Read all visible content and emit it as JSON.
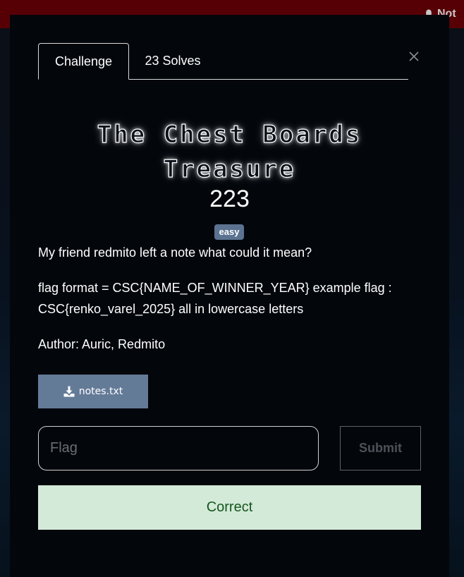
{
  "topbar": {
    "notifications_label": "Not"
  },
  "tabs": [
    {
      "label": "Challenge"
    },
    {
      "label": "23 Solves"
    }
  ],
  "challenge": {
    "title": "The Chest Boards Treasure",
    "points": "223",
    "difficulty": "easy",
    "description": [
      "My friend redmito left a note what could it mean?",
      "flag format = CSC{NAME_OF_WINNER_YEAR} example flag : CSC{renko_varel_2025} all in lowercase letters",
      "Author: Auric, Redmito"
    ]
  },
  "file": {
    "name": "notes.txt",
    "icon": "download-icon"
  },
  "form": {
    "flag_placeholder": "Flag",
    "flag_value": "",
    "submit_label": "Submit"
  },
  "result": {
    "message": "Correct"
  },
  "colors": {
    "header": "#560006",
    "modal_bg": "#03070c",
    "badge": "#5b7291",
    "download_button": "#647b98",
    "result_bg": "#d4ead9",
    "result_text": "#15571d"
  }
}
